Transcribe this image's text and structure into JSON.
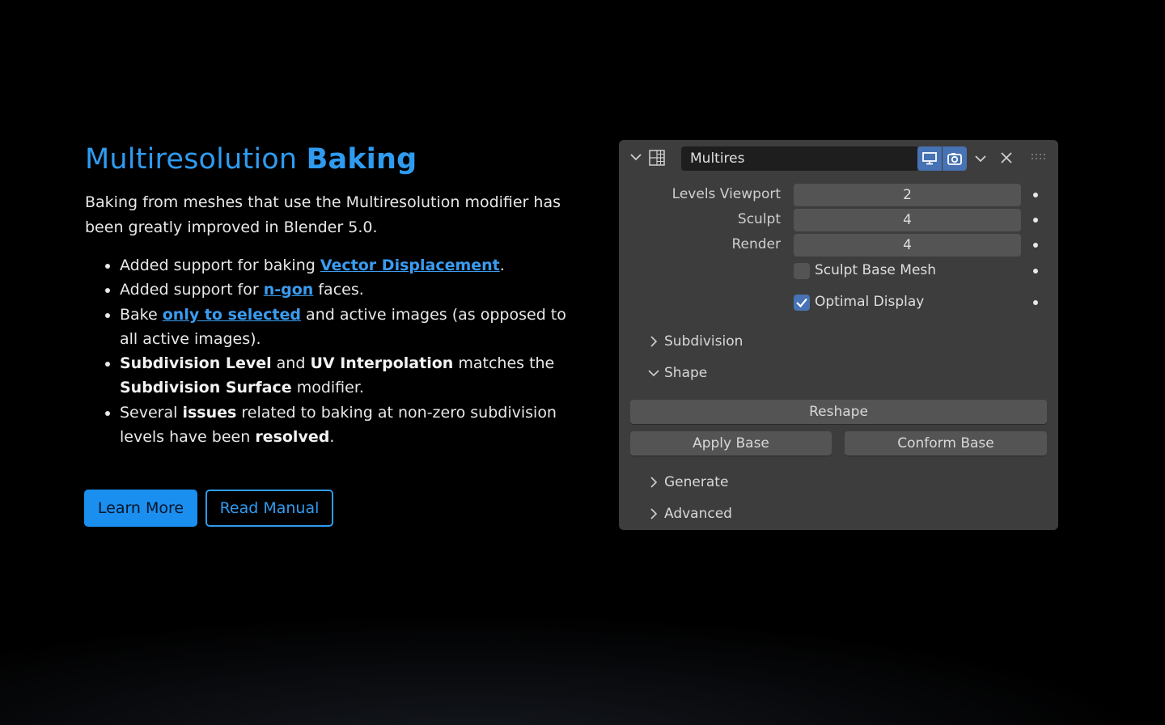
{
  "left": {
    "title_light": "Multiresolution",
    "title_bold": "Baking",
    "intro": "Baking from meshes that use the Multiresolution modifier has been greatly improved in Blender 5.0.",
    "bullets": [
      {
        "pre": "Added support for baking ",
        "link": "Vector Displacement",
        "post": "."
      },
      {
        "pre": "Added support for ",
        "link": "n-gon",
        "post": " faces."
      },
      {
        "pre": "Bake ",
        "link": "only to selected",
        "post": " and active images (as opposed to all active images)."
      },
      {
        "b1": "Subdivision Level",
        "t1": " and ",
        "b2": "UV Interpolation",
        "t2": " matches the ",
        "b3": "Subdivision Surface",
        "t3": " modifier."
      },
      {
        "t0": "Several ",
        "b1": "issues",
        "t1": " related to baking at non-zero subdivision levels have been ",
        "b2": "resolved",
        "t2": "."
      }
    ],
    "buttons": {
      "learn_more": "Learn More",
      "read_manual": "Read Manual"
    }
  },
  "panel": {
    "modifier_name": "Multires",
    "fields": {
      "levels_viewport_label": "Levels Viewport",
      "levels_viewport_value": "2",
      "sculpt_label": "Sculpt",
      "sculpt_value": "4",
      "render_label": "Render",
      "render_value": "4"
    },
    "checkboxes": {
      "sculpt_base_mesh": "Sculpt Base Mesh",
      "sculpt_base_mesh_checked": false,
      "optimal_display": "Optimal Display",
      "optimal_display_checked": true
    },
    "sections": {
      "subdivision": "Subdivision",
      "shape": "Shape",
      "generate": "Generate",
      "advanced": "Advanced"
    },
    "shape_buttons": {
      "reshape": "Reshape",
      "apply_base": "Apply Base",
      "conform_base": "Conform Base"
    }
  },
  "colors": {
    "accent": "#2f9bf0",
    "panel_bg": "#3d3d3d",
    "field_bg": "#545454",
    "toggle_active": "#4772b3"
  }
}
